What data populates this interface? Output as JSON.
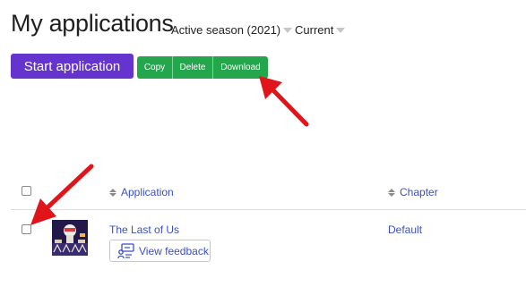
{
  "page": {
    "title": "My applications"
  },
  "filters": {
    "season": "Active season (2021)",
    "status": "Current"
  },
  "toolbar": {
    "start_label": "Start application",
    "copy_label": "Copy",
    "delete_label": "Delete",
    "download_label": "Download"
  },
  "table": {
    "headers": {
      "application": "Application",
      "chapter": "Chapter"
    },
    "rows": [
      {
        "application": "The Last of Us",
        "chapter": "Default",
        "feedback_label": "View feedback"
      }
    ]
  },
  "colors": {
    "primary": "#6534cf",
    "success": "#24a64d",
    "link": "#3b4fc4",
    "annotation_arrow": "#e0141b"
  },
  "icons": {
    "feedback": "presentation-person-icon",
    "sort": "sort-updown-icon",
    "filter_caret": "caret-down-icon"
  }
}
